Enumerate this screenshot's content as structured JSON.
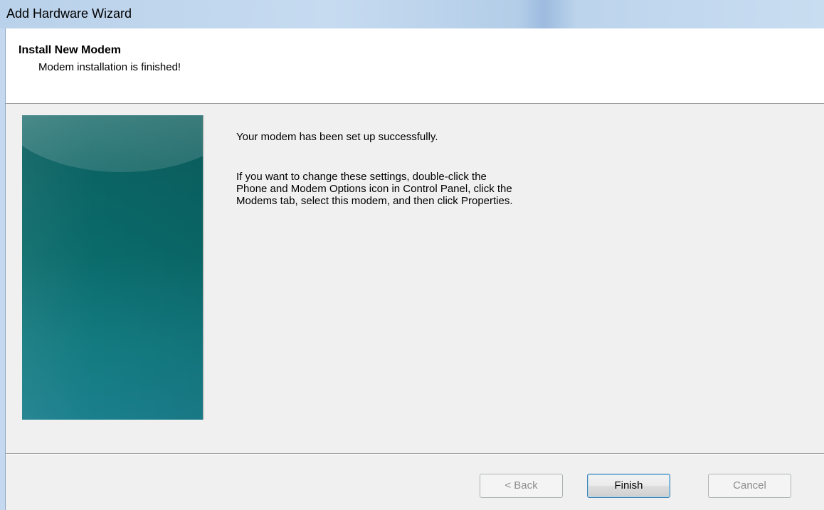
{
  "window": {
    "title": "Add Hardware Wizard"
  },
  "header": {
    "title": "Install New Modem",
    "subtitle": "Modem installation is finished!"
  },
  "body": {
    "line1": "Your modem has been set up successfully.",
    "line2": "If you want to change these settings, double-click the\nPhone and Modem Options icon in Control Panel, click the\nModems tab, select this modem, and then click Properties."
  },
  "buttons": {
    "back": "< Back",
    "finish": "Finish",
    "cancel": "Cancel"
  },
  "colors": {
    "banner": "#0a6a6a",
    "header_bg": "#ffffff",
    "dialog_bg": "#f0f0f0",
    "default_button_border": "#3c7fb1"
  }
}
